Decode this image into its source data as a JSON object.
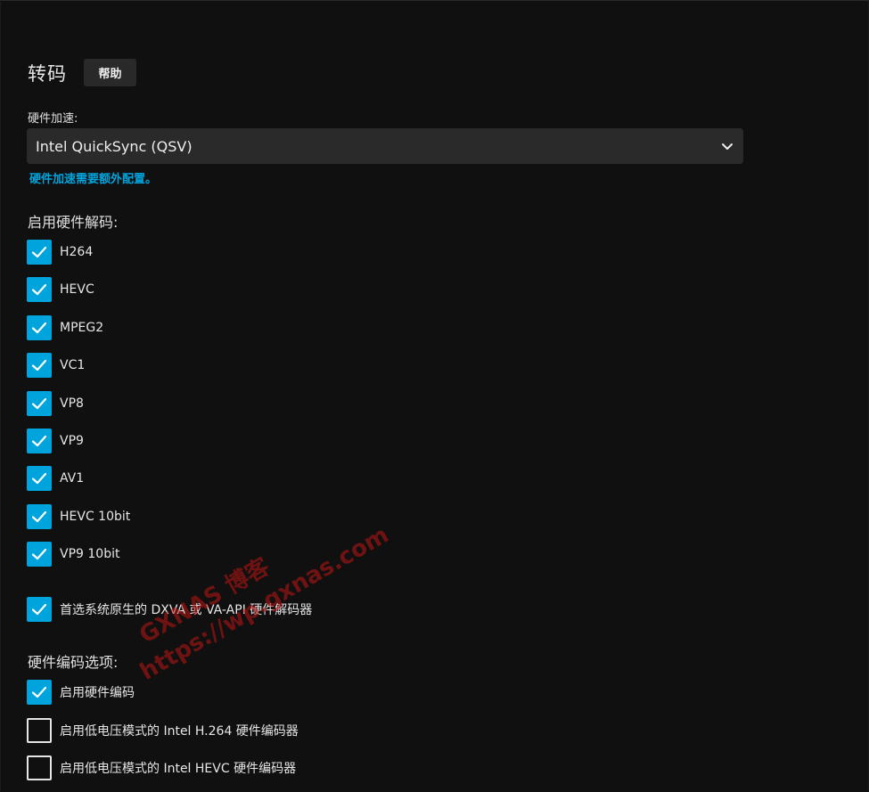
{
  "page": {
    "title": "转码",
    "help_label": "帮助"
  },
  "hardware_acceleration": {
    "label": "硬件加速:",
    "selected": "Intel QuickSync (QSV)",
    "note": "硬件加速需要额外配置。"
  },
  "decoding": {
    "title": "启用硬件解码:",
    "items": [
      {
        "label": "H264",
        "checked": true
      },
      {
        "label": "HEVC",
        "checked": true
      },
      {
        "label": "MPEG2",
        "checked": true
      },
      {
        "label": "VC1",
        "checked": true
      },
      {
        "label": "VP8",
        "checked": true
      },
      {
        "label": "VP9",
        "checked": true
      },
      {
        "label": "AV1",
        "checked": true
      },
      {
        "label": "HEVC 10bit",
        "checked": true
      },
      {
        "label": "VP9 10bit",
        "checked": true
      }
    ],
    "prefer_native": {
      "label": "首选系统原生的 DXVA 或 VA-API 硬件解码器",
      "checked": true
    }
  },
  "encoding": {
    "title": "硬件编码选项:",
    "items": [
      {
        "label": "启用硬件编码",
        "checked": true
      },
      {
        "label": "启用低电压模式的 Intel H.264 硬件编码器",
        "checked": false
      },
      {
        "label": "启用低电压模式的 Intel HEVC 硬件编码器",
        "checked": false
      }
    ]
  },
  "watermark": {
    "line1": "GXNAS 博客",
    "line2": "https://wp.gxnas.com"
  },
  "colors": {
    "accent": "#00a4dc",
    "background": "#101010",
    "input_bg": "#2a2a2a"
  }
}
